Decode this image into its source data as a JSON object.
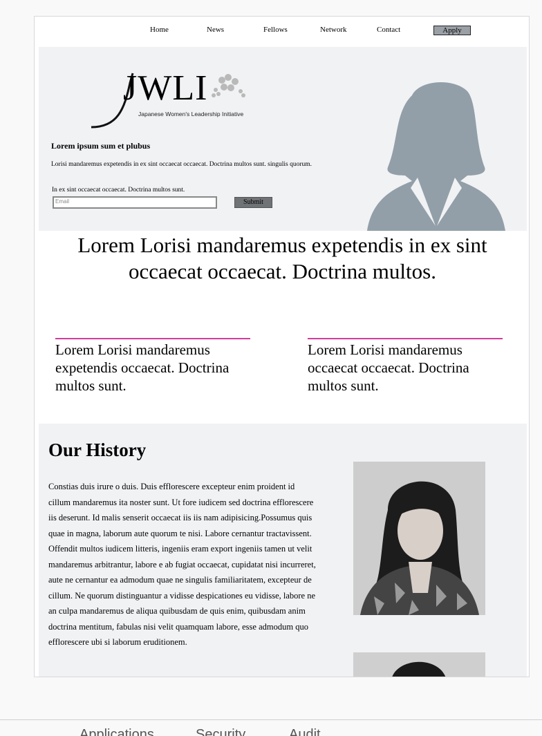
{
  "nav": {
    "items": [
      "Home",
      "News",
      "Fellows",
      "Network",
      "Contact"
    ],
    "apply_label": "Apply"
  },
  "hero": {
    "logo_text": "JWLI",
    "logo_subtitle": "Japanese Women's Leadership Initiative",
    "title": "Lorem ipsum sum et plubus",
    "description": "Lorisi mandaremus expetendis in ex sint occaecat occaecat. Doctrina multos sunt. singulis quorum.",
    "email_label": "In ex sint occaecat occaecat. Doctrina multos sunt.",
    "email_placeholder": "Email",
    "submit_label": "Submit",
    "avatar_icon": "female-avatar-silhouette-icon"
  },
  "tagline": "Lorem Lorisi mandaremus expetendis in ex sint occaecat occaecat. Doctrina multos.",
  "features": [
    "Lorem Lorisi mandaremus expetendis occaecat. Doctrina multos sunt.",
    "Lorem Lorisi mandaremus occaecat occaecat. Doctrina multos sunt."
  ],
  "history": {
    "heading": "Our History",
    "body": "Constias duis irure o duis. Duis efflorescere excepteur enim proident id cillum mandaremus ita noster sunt. Ut fore iudicem sed doctrina efflorescere iis deserunt. Id malis senserit occaecat iis iis nam adipisicing.Possumus quis quae in magna, laborum aute quorum te nisi. Labore cernantur tractavissent. Offendit multos iudicem litteris, ingeniis eram export ingeniis tamen ut velit mandaremus arbitrantur, labore e ab fugiat occaecat, cupidatat nisi incurreret, aute ne cernantur ea admodum quae ne singulis familiaritatem, excepteur de cillum. Ne quorum distinguantur a vidisse despicationes eu vidisse, labore ne an culpa mandaremus de aliqua quibusdam de quis enim, quibusdam anim doctrina mentitum, fabulas nisi velit quamquam labore, esse admodum quo efflorescere ubi si laborum eruditionem."
  },
  "bottom_bar": {
    "items": [
      "Applications",
      "Security",
      "Audit"
    ]
  },
  "colors": {
    "accent_pink": "#d43a9b",
    "hero_bg": "#f1f2f4",
    "avatar_gray": "#929fa8"
  }
}
